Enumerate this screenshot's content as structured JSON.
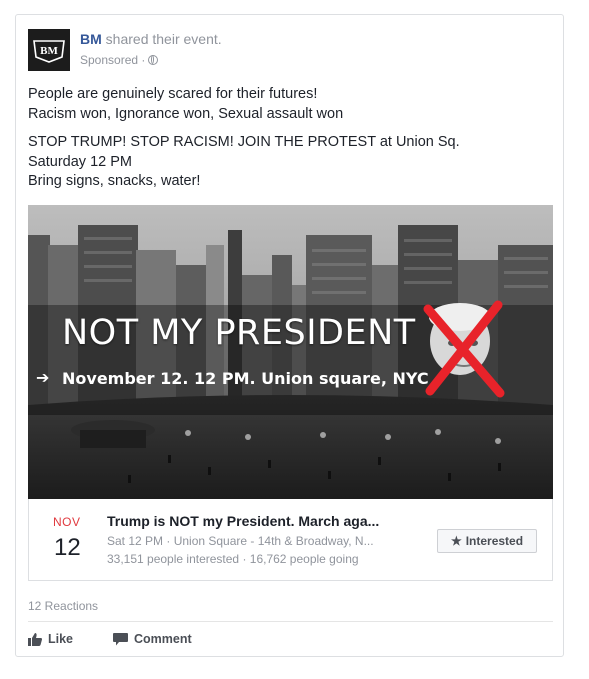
{
  "post": {
    "author": "BM",
    "action": "shared their event.",
    "sponsored": "Sponsored ·",
    "avatar_text": "BM",
    "lines_a": [
      "People are genuinely scared for their futures!",
      "Racism won, Ignorance won, Sexual assault won"
    ],
    "lines_b": [
      "STOP TRUMP! STOP RACISM! JOIN THE PROTEST at Union Sq.",
      "Saturday 12 PM",
      "Bring signs, snacks, water!"
    ]
  },
  "hero": {
    "title": "NOT MY PRESIDENT",
    "subtitle": "November 12. 12 PM. Union square, NYC"
  },
  "event": {
    "month": "NOV",
    "day": "12",
    "title": "Trump is NOT my President. March aga...",
    "details": "Sat 12 PM · Union Square - 14th & Broadway, N...",
    "stats": "33,151 people interested · 16,762 people going",
    "interested_label": "Interested"
  },
  "footer": {
    "reactions": "12 Reactions",
    "like_label": "Like",
    "comment_label": "Comment"
  },
  "colors": {
    "link": "#365899",
    "muted": "#90949c",
    "month_red": "#e0393e",
    "cross_red": "#e8232a"
  },
  "icons": [
    "globe-icon",
    "star-icon",
    "thumbs-up-icon",
    "comment-icon",
    "arrow-icon"
  ]
}
